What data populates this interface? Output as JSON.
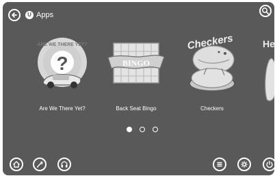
{
  "header": {
    "back_icon": "back-arrow-icon",
    "app_badge": "U",
    "title": "Apps",
    "search_icon": "search-icon"
  },
  "carousel": {
    "apps": [
      {
        "label": "Are We There Yet?",
        "logo_text": "ARE WE THERE YET?",
        "icon": "car-question-icon"
      },
      {
        "label": "Back Seat Bingo",
        "logo_text": "BINGO",
        "icon": "bingo-card-icon"
      },
      {
        "label": "Checkers",
        "logo_text": "Checkers",
        "icon": "checkers-icon"
      },
      {
        "label": "",
        "logo_text": "He",
        "icon": "partial-app-icon"
      }
    ],
    "pages": 3,
    "current_page": 1
  },
  "bottom_bar": {
    "left_icons": [
      "home-icon",
      "navigation-icon",
      "headphones-icon"
    ],
    "right_icons": [
      "menu-icon",
      "settings-icon",
      "power-icon"
    ]
  }
}
